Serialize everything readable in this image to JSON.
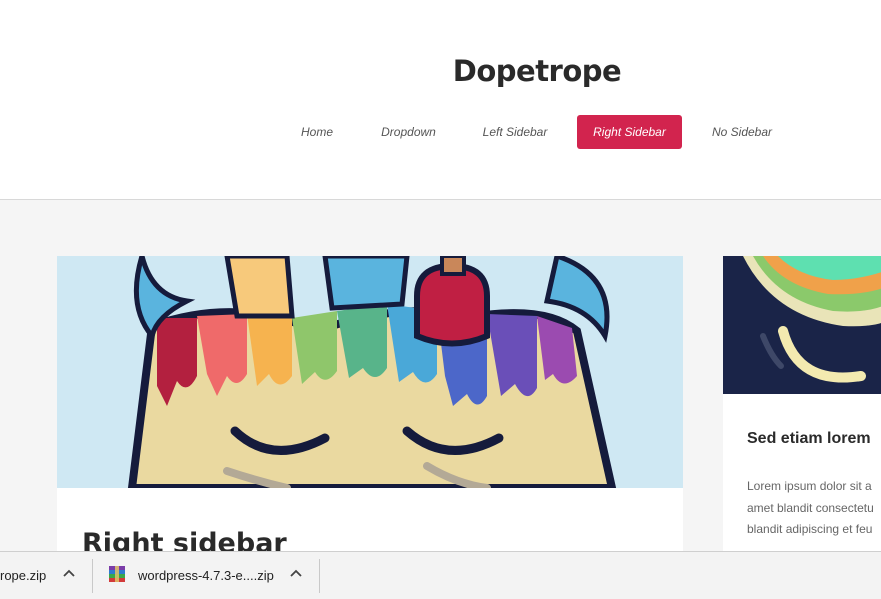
{
  "site": {
    "title": "Dopetrope"
  },
  "nav": {
    "items": [
      {
        "label": "Home"
      },
      {
        "label": "Dropdown"
      },
      {
        "label": "Left Sidebar"
      },
      {
        "label": "Right Sidebar",
        "active": true
      },
      {
        "label": "No Sidebar"
      }
    ],
    "active_color": "#d2244e"
  },
  "main": {
    "post_title": "Right sidebar"
  },
  "sidebar": {
    "title": "Sed etiam lorem",
    "text_lines": [
      "Lorem ipsum dolor sit a",
      "amet blandit consectetu",
      "blandit adipiscing et feu"
    ]
  },
  "downloads": {
    "items": [
      {
        "name": "rope.zip",
        "icon": "chevron-up-icon"
      },
      {
        "name": "wordpress-4.7.3-e....zip",
        "icon": "winrar-archive-icon"
      }
    ]
  }
}
